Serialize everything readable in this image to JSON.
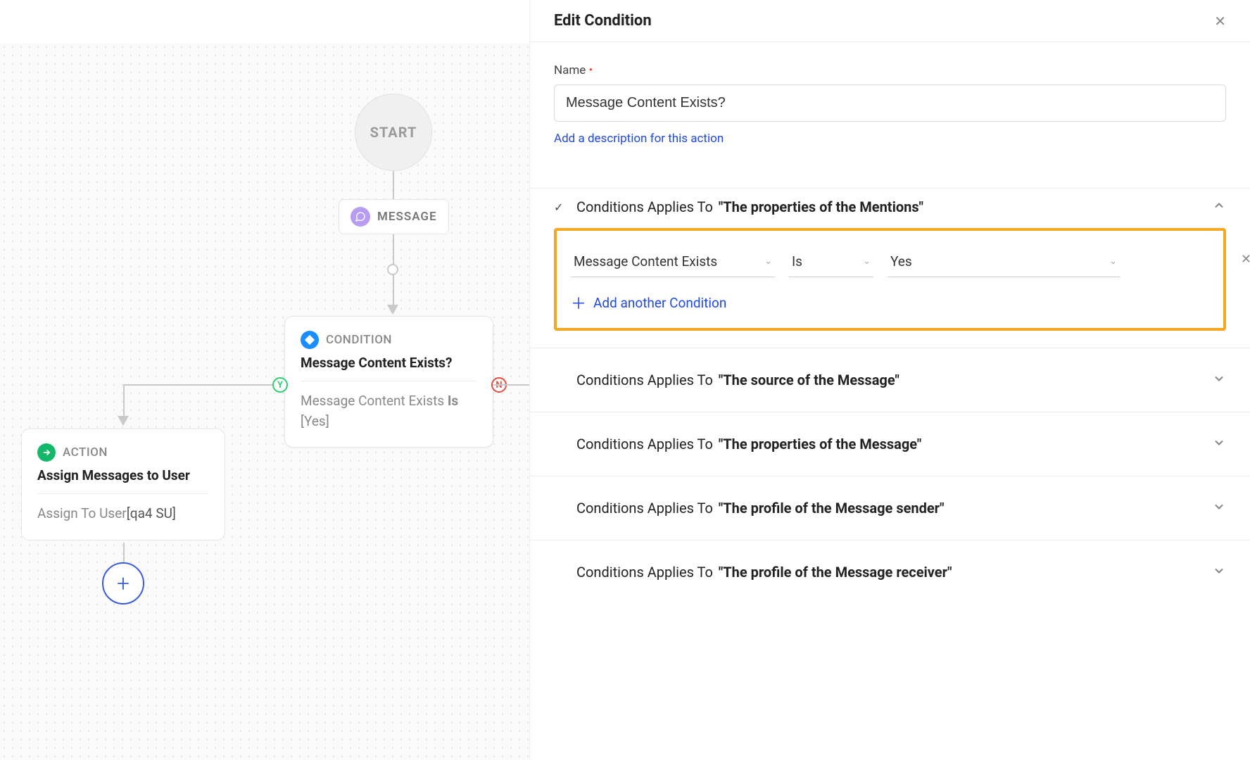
{
  "canvas": {
    "start_label": "START",
    "message_label": "MESSAGE",
    "condition": {
      "type_label": "CONDITION",
      "title": "Message Content Exists?",
      "detail_field": "Message Content Exists",
      "detail_op": "Is",
      "detail_value": "[Yes]"
    },
    "action": {
      "type_label": "ACTION",
      "title": "Assign Messages to User",
      "detail_label": "Assign To User",
      "detail_value": "[qa4 SU]"
    },
    "branch_yes": "Y",
    "branch_no": "N"
  },
  "panel": {
    "title": "Edit Condition",
    "name_label": "Name",
    "name_value": "Message Content Exists?",
    "description_link": "Add a description for this action",
    "section_prefix": "Conditions Applies To",
    "sections": [
      {
        "target": "\"The properties of the Mentions\"",
        "expanded": true,
        "checked": true
      },
      {
        "target": "\"The source of the Message\"",
        "expanded": false,
        "checked": false
      },
      {
        "target": "\"The properties of the Message\"",
        "expanded": false,
        "checked": false
      },
      {
        "target": "\"The profile of the Message sender\"",
        "expanded": false,
        "checked": false
      },
      {
        "target": "\"The profile of the Message receiver\"",
        "expanded": false,
        "checked": false
      }
    ],
    "condition_row": {
      "field": "Message Content Exists",
      "operator": "Is",
      "value": "Yes"
    },
    "add_condition_label": "Add another Condition"
  }
}
